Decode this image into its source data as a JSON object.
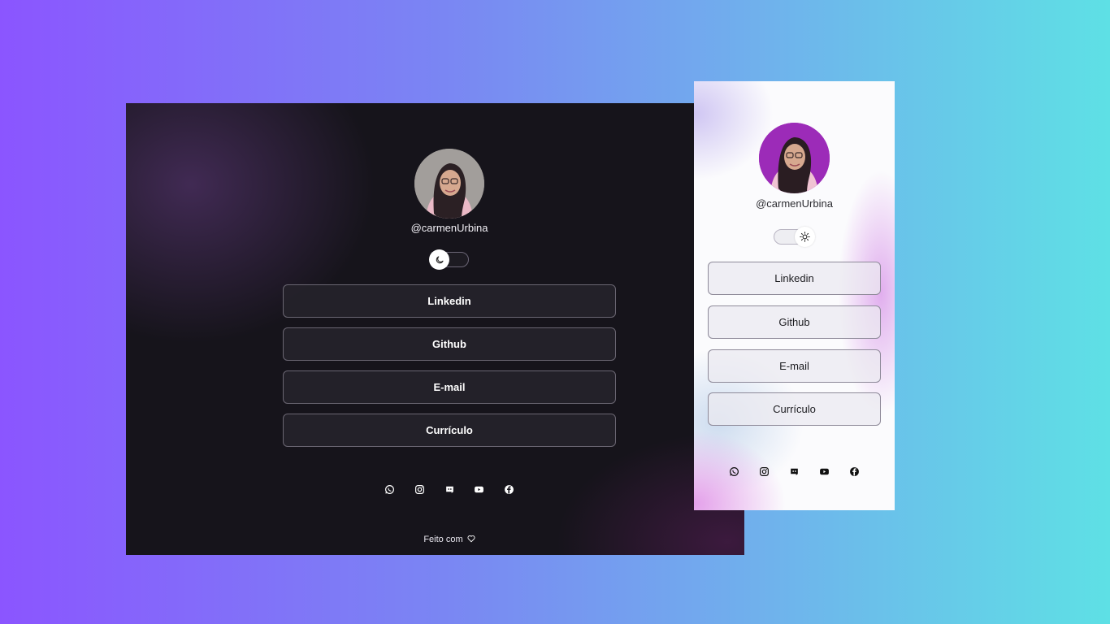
{
  "dark": {
    "username": "@carmenUrbina",
    "links": [
      "Linkedin",
      "Github",
      "E-mail",
      "Currículo"
    ],
    "footer": "Feito com"
  },
  "light": {
    "username": "@carmenUrbina",
    "links": [
      "Linkedin",
      "Github",
      "E-mail",
      "Currículo"
    ]
  },
  "socials": [
    "whatsapp-icon",
    "instagram-icon",
    "discord-icon",
    "youtube-icon",
    "facebook-icon"
  ],
  "colors": {
    "background_left": "#8b55ff",
    "background_right": "#5ee0e5",
    "dark_card": "#16141b",
    "light_avatar_bg": "#9c2bb8"
  }
}
